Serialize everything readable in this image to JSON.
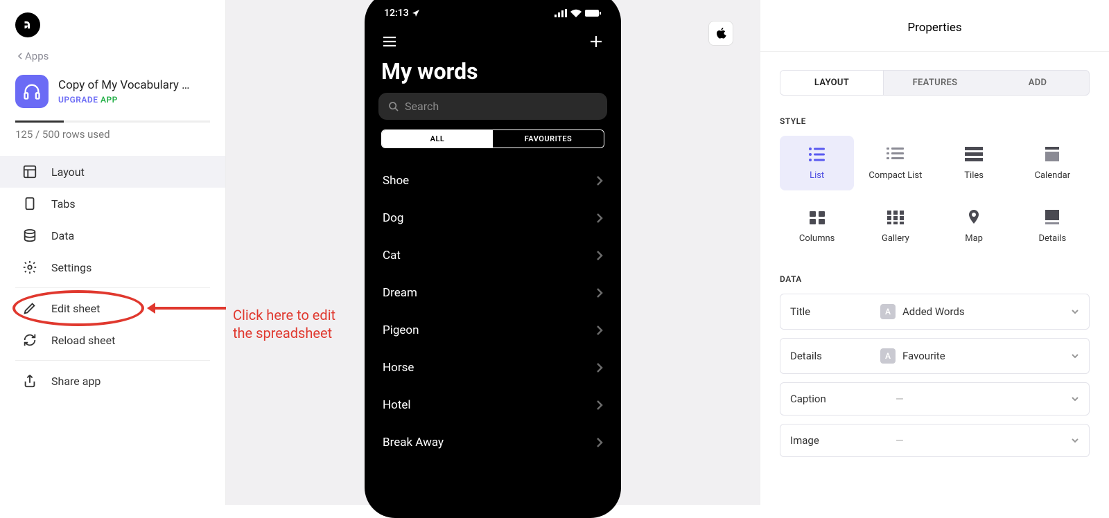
{
  "sidebar": {
    "back": "Apps",
    "app_name": "Copy of My Vocabulary …",
    "upgrade1": "UPGRADE",
    "upgrade2": "APP",
    "rows_used": "125 / 500 rows used",
    "progress_pct": 25,
    "items": [
      {
        "label": "Layout"
      },
      {
        "label": "Tabs"
      },
      {
        "label": "Data"
      },
      {
        "label": "Settings"
      },
      {
        "label": "Edit sheet"
      },
      {
        "label": "Reload sheet"
      },
      {
        "label": "Share app"
      }
    ]
  },
  "annotation": {
    "text": "Click here to edit\nthe spreadsheet"
  },
  "phone": {
    "time": "12:13",
    "title": "My words",
    "search_placeholder": "Search",
    "seg_all": "ALL",
    "seg_fav": "FAVOURITES",
    "words": [
      "Shoe",
      "Dog",
      "Cat",
      "Dream",
      "Pigeon",
      "Horse",
      "Hotel",
      "Break Away"
    ]
  },
  "right": {
    "title": "Properties",
    "tabs": {
      "layout": "LAYOUT",
      "features": "FEATURES",
      "add": "ADD"
    },
    "style_label": "STYLE",
    "styles": [
      "List",
      "Compact List",
      "Tiles",
      "Calendar",
      "Columns",
      "Gallery",
      "Map",
      "Details"
    ],
    "data_label": "DATA",
    "data_rows": [
      {
        "k": "Title",
        "v": "Added Words",
        "badge": "A"
      },
      {
        "k": "Details",
        "v": "Favourite",
        "badge": "A"
      },
      {
        "k": "Caption",
        "v": "—"
      },
      {
        "k": "Image",
        "v": "—"
      }
    ]
  }
}
